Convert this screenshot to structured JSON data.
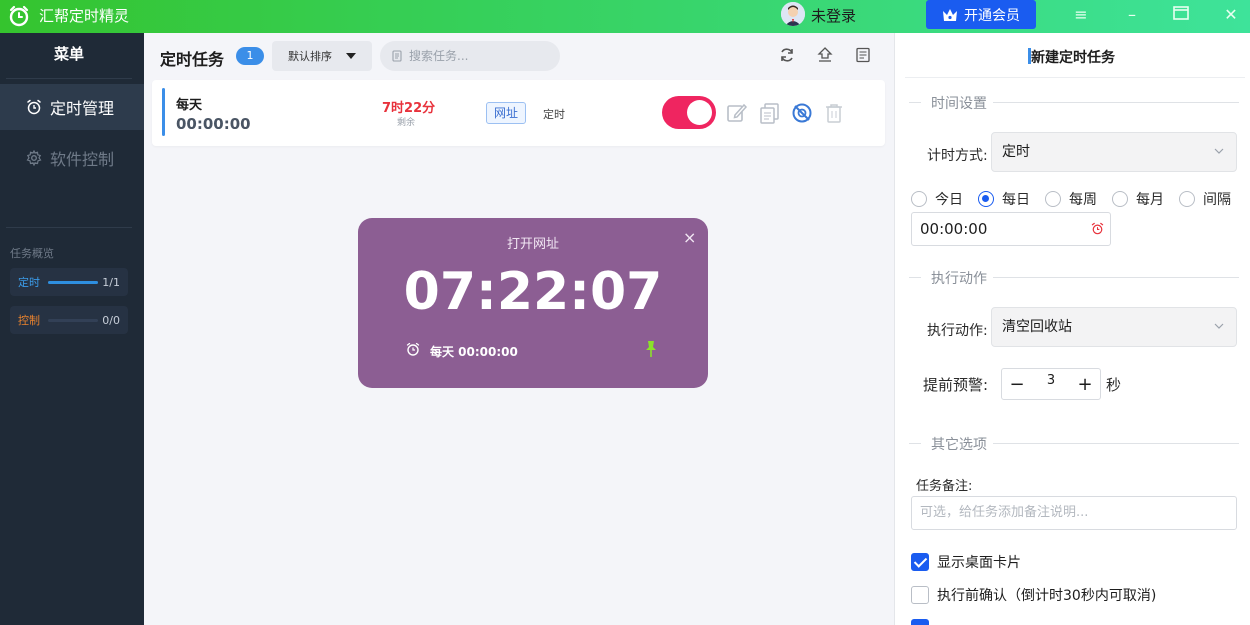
{
  "app": {
    "name": "汇帮定时精灵",
    "user_label": "未登录",
    "vip_button": "开通会员",
    "window_controls": [
      "menu-icon",
      "minimize-icon",
      "maximize-icon",
      "close-icon"
    ],
    "accent_color": "#35c42e"
  },
  "sidebar": {
    "title": "菜单",
    "items": [
      {
        "label": "定时管理",
        "icon": "alarm-clock-icon",
        "active": true
      },
      {
        "label": "软件控制",
        "icon": "gear-icon",
        "active": false
      }
    ],
    "overview_label": "任务概览",
    "overview": [
      {
        "label": "定时",
        "count": "1/1",
        "progress": 1.0,
        "color": "#2e8fe0"
      },
      {
        "label": "控制",
        "count": "0/0",
        "progress": 0.0,
        "color": "#e8822e"
      }
    ]
  },
  "main": {
    "title": "定时任务",
    "count": "1",
    "sort_label": "默认排序",
    "search_placeholder": "搜索任务...",
    "header_icons": [
      "refresh-icon",
      "import-icon",
      "log-icon"
    ]
  },
  "task": {
    "frequency": "每天",
    "time": "00:00:00",
    "remaining": "7时22分",
    "remaining_label": "剩余",
    "tag": "网址",
    "type": "定时",
    "enabled": true,
    "action_icons": [
      "edit-icon",
      "copy-icon",
      "disable-icon",
      "delete-icon"
    ]
  },
  "float_card": {
    "title": "打开网址",
    "countdown": "07:22:07",
    "schedule": "每天 00:00:00",
    "close_glyph": "×",
    "bg_color": "#8c5e93"
  },
  "panel": {
    "title": "新建定时任务",
    "sections": {
      "time": "时间设置",
      "action": "执行动作",
      "other": "其它选项"
    },
    "timing_mode_label": "计时方式:",
    "timing_mode_value": "定时",
    "recurrence": [
      {
        "label": "今日",
        "selected": false
      },
      {
        "label": "每日",
        "selected": true
      },
      {
        "label": "每周",
        "selected": false
      },
      {
        "label": "每月",
        "selected": false
      },
      {
        "label": "间隔",
        "selected": false
      }
    ],
    "time_value": "00:00:00",
    "action_label": "执行动作:",
    "action_value": "清空回收站",
    "warning_label": "提前预警:",
    "warning_value": "3",
    "warning_unit": "秒",
    "note_label": "任务备注:",
    "note_placeholder": "可选，给任务添加备注说明...",
    "checkboxes": [
      {
        "label": "显示桌面卡片",
        "checked": true
      },
      {
        "label": "执行前确认（倒计时30秒内可取消)",
        "checked": false
      }
    ]
  }
}
